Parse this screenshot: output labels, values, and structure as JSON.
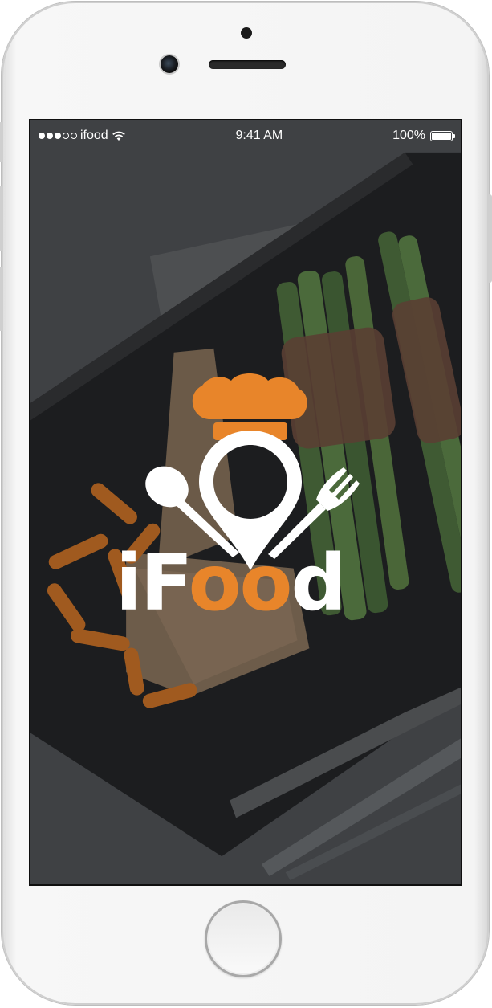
{
  "status_bar": {
    "carrier": "ifood",
    "time": "9:41 AM",
    "battery": "100%",
    "signal_dots_filled": 3,
    "signal_dots_total": 5
  },
  "logo": {
    "text_part1": "iF",
    "text_part2": "oo",
    "text_part3": "d"
  },
  "colors": {
    "accent": "#E8852A",
    "overlay": "#2F3134",
    "logo_white": "#FFFFFF"
  },
  "icons": [
    "wifi-icon",
    "battery-icon",
    "chef-hat-icon",
    "location-pin-icon",
    "spoon-icon",
    "fork-icon"
  ]
}
